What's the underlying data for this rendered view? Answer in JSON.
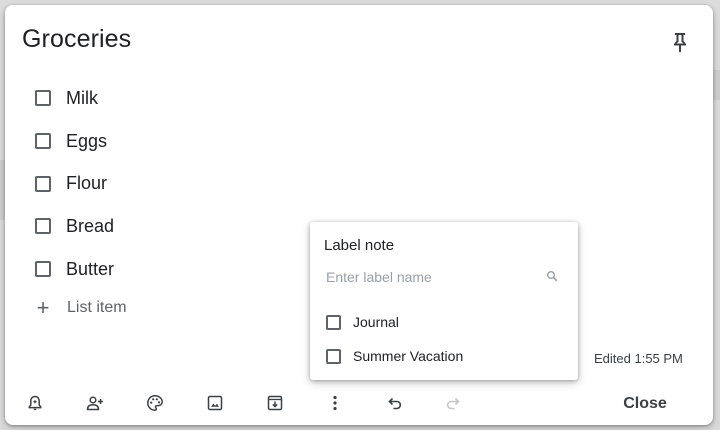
{
  "note": {
    "title": "Groceries",
    "items": [
      {
        "text": "Milk",
        "checked": false
      },
      {
        "text": "Eggs",
        "checked": false
      },
      {
        "text": "Flour",
        "checked": false
      },
      {
        "text": "Bread",
        "checked": false
      },
      {
        "text": "Butter",
        "checked": false
      }
    ],
    "add_item_label": "List item",
    "edited": "Edited 1:55 PM"
  },
  "toolbar": {
    "icons": [
      "remind-bell-icon",
      "collaborator-icon",
      "palette-icon",
      "image-icon",
      "archive-icon",
      "more-vert-icon",
      "undo-icon",
      "redo-icon"
    ],
    "close_label": "Close"
  },
  "label_popup": {
    "title": "Label note",
    "search_placeholder": "Enter label name",
    "labels": [
      {
        "name": "Journal",
        "checked": false
      },
      {
        "name": "Summer Vacation",
        "checked": false
      }
    ]
  },
  "colors": {
    "text": "#202124",
    "icon": "#5f6368",
    "placeholder": "#9aa0a6",
    "background": "#dcdcdc"
  }
}
